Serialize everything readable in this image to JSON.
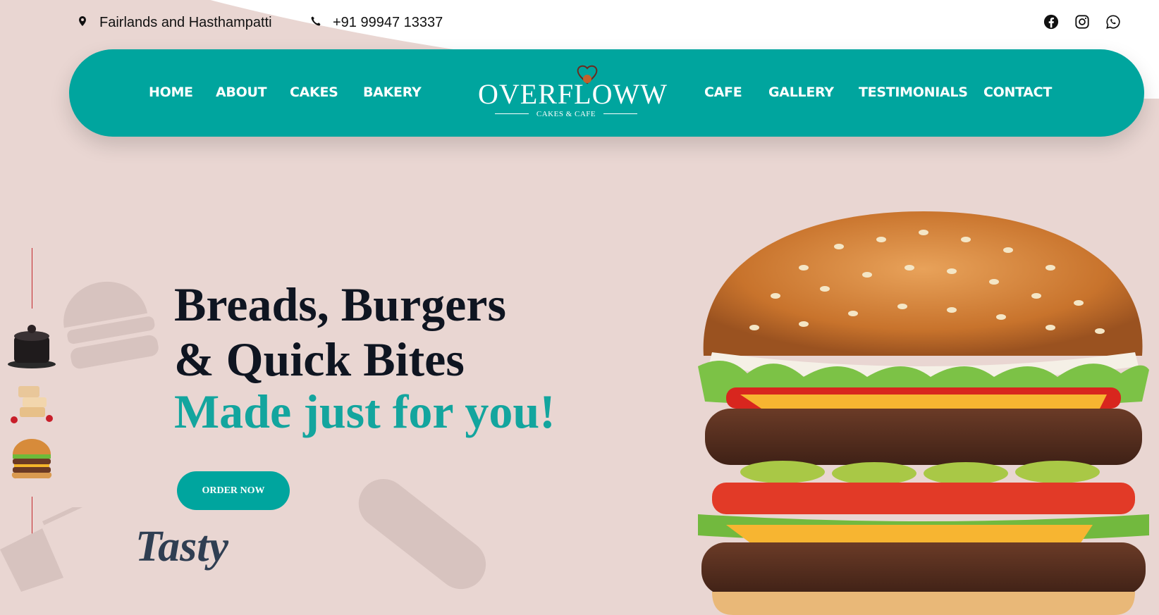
{
  "topbar": {
    "location": "Fairlands and Hasthampatti",
    "phone": "+91 99947 13337",
    "socials": [
      "facebook-icon",
      "instagram-icon",
      "whatsapp-icon"
    ]
  },
  "nav": {
    "left": [
      "HOME",
      "ABOUT",
      "CAKES",
      "BAKERY"
    ],
    "right": [
      "CAFE",
      "GALLERY",
      "TESTIMONIALS",
      "CONTACT"
    ],
    "logo_main": "OVERFLOWW",
    "logo_sub": "CAKES & CAFE"
  },
  "hero": {
    "line1": "Breads, Burgers",
    "line2": "& Quick Bites",
    "accent": "Made just for you!",
    "cta": "ORDER NOW",
    "tasty": "Tasty"
  },
  "colors": {
    "brand": "#00a59e",
    "background": "#e9d6d2",
    "heading": "#0f1521"
  }
}
